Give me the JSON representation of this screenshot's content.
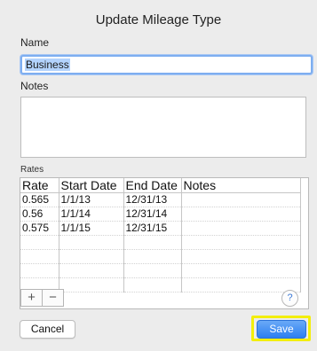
{
  "dialog": {
    "title": "Update Mileage Type",
    "name_label": "Name",
    "name_value": "Business",
    "notes_label": "Notes",
    "notes_value": "",
    "rates_label": "Rates",
    "rates_columns": [
      "Rate",
      "Start Date",
      "End Date",
      "Notes"
    ],
    "rates_rows": [
      [
        "0.565",
        "1/1/13",
        "12/31/13",
        ""
      ],
      [
        "0.56",
        "1/1/14",
        "12/31/14",
        ""
      ],
      [
        "0.575",
        "1/1/15",
        "12/31/15",
        ""
      ],
      [
        "",
        "",
        "",
        ""
      ],
      [
        "",
        "",
        "",
        ""
      ],
      [
        "",
        "",
        "",
        ""
      ],
      [
        "",
        "",
        "",
        ""
      ]
    ],
    "add_label": "+",
    "remove_label": "−",
    "help_label": "?",
    "cancel_label": "Cancel",
    "save_label": "Save",
    "colors": {
      "save_button": "#2c7ff0",
      "highlight": "#f3ee0b",
      "selection": "#b3d3fd"
    }
  }
}
